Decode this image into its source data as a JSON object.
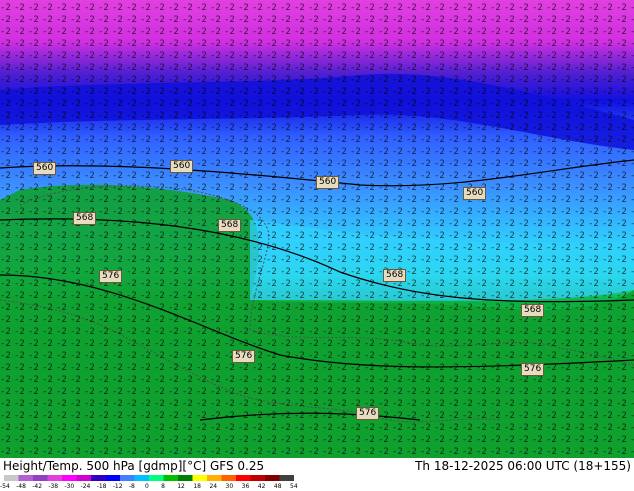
{
  "title": "Height/Temp. 500 hPa [gdmp][°C] GFS 0.25",
  "run_info": "Th 18-12-2025 06:00 UTC (18+155)",
  "contour_labels": [
    "560",
    "560",
    "560",
    "560",
    "568",
    "568",
    "576",
    "568",
    "568",
    "576",
    "576",
    "576"
  ],
  "colorbar": {
    "ticks": [
      "-54",
      "-48",
      "-42",
      "-38",
      "-30",
      "-24",
      "-18",
      "-12",
      "-8",
      "0",
      "8",
      "12",
      "18",
      "24",
      "30",
      "36",
      "42",
      "48",
      "54"
    ],
    "colors": [
      "#c8c8c8",
      "#b060d0",
      "#9040c0",
      "#e040e0",
      "#ff00ff",
      "#d000d0",
      "#3000c0",
      "#0000ff",
      "#4080ff",
      "#00c0ff",
      "#00ff80",
      "#00c000",
      "#008000",
      "#ffff00",
      "#ffb000",
      "#ff6000",
      "#ff0000",
      "#c00000",
      "#800000",
      "#404040"
    ]
  }
}
